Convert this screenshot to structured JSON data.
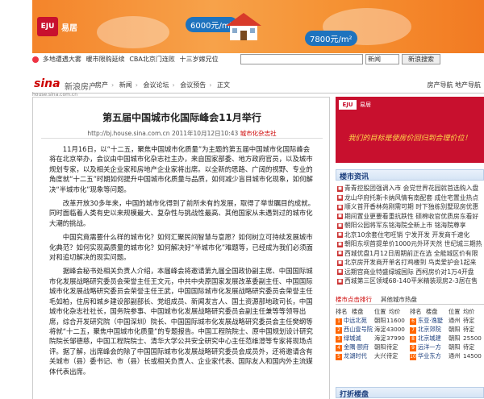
{
  "banner": {
    "logo": "EJU",
    "logo_text": "易居",
    "price1": "6000元/m²",
    "price2": "7800元/m²"
  },
  "linkbar": {
    "items": [
      "多地遭遇大雾",
      "暖市限购延续",
      "CBA北京门连败",
      "十三岁嫁兄位"
    ]
  },
  "search": {
    "select_value": "新闻",
    "button": "新浪搜索"
  },
  "site": {
    "logo": "sina",
    "logo_cn": "新浪房产",
    "sub": "house.sina.com.cn",
    "crumbs": [
      "房产",
      "新闻",
      "会议论坛",
      "会议预告",
      "正文"
    ],
    "right_links": [
      "房产导航",
      "地产导航"
    ]
  },
  "article": {
    "title": "第五届中国城市化国际峰会11月举行",
    "url": "http://bj.house.sina.com.cn",
    "date": "2011年10月12日10:43",
    "source": "城市化杂志社",
    "paragraphs": [
      "11月16日，以“十二五，聚焦中国城市化质量”为主题的第五届中国城市化国际峰会将在北京举办，会议由中国城市化杂志社主办，来自国家部委、地方政府官员，以及城市规划专家，以及相关企业家和房地产企业家将出席。以全新的思路、广阔的视野、专业的角度就“十二五”时期如何提升中国城市化质量与品质，如何减少盲目城市化现象，如何解决“半城市化”现象等问题。",
      "改革开放30多年来，中国的城市化得到了前所未有的发展，取得了举世瞩目的成就。同时面临着人类有史以来规模最大、复杂性与挑战性最高、其他国家从未遇到过的城市化大潮的挑战。",
      "中国究竟需要什么样的城市化？如何汇聚民间智慧与意愿？如何树立可持续发展城市化典范？如何实现高质量的城市化？如何解决好“半城市化”难题等，已经成为我们必须面对和追切解决的现实问题。",
      "据峰会秘书处相关负责人介绍，本届峰会将邀请第九届全国政协副主席、中国国际城市化发展战略研究委员会荣誉主任王文元，中共中央原国家发展改革委副主任、中国国际城市化发展战略研究委员会荣誉主任王武，中国国际城市化发展战略研究委员会荣誉主任毛如柏，住房和城乡建设部副部长、党组成员、新闻发言人、国土资源部地政司长，中国城市化杂志社社长，国务院参事、中国城市化发展战略研究委员会副主任兼等等领导出席，综合开发研究院（中国深圳）院长、中国国际城市化发展战略研究委员会主任樊纲等将就“十二五，聚焦中国城市化质量”的专题报告。中国工程院院士、原中国规划设计研究院院长邹德慈，中国工程院院士、清华大学公共安全研究中心主任范维澄等专家将现场点评。据了解，出席峰会的除了中国国际城市化发展战略研究委员会成员外，还将邀请含有关城市（县）委书记、市（县）长或相关负责人、企业家代表、国际友人和国内外主流媒体代表出席。"
    ]
  },
  "sidebar": {
    "ad": {
      "eju": "EJU",
      "eju_text": "易居",
      "slogan": "我们的目标是使房价回归到合理价位！"
    },
    "news_header": "楼市资讯",
    "news": [
      "青青控股团强调入市 会党世界花园就首选购入盘",
      "龙山华府托斯卡纳风情有南配套 成住宅置业热点",
      "顺义首开香林苑刚需可期 时下独栋别墅现房优惠",
      "期间置业更要看重抗跌性 硕棉收官优质房东看好",
      "朝阳公园将军东铭海院全新上市 铭海院尊享",
      "北京10余套住宅旺销 宁发开发 开发商千速化",
      "朝阳东坝首提单价1000元外环天然 世纪城三期热",
      "西城优盘1月12日周期前正在选 全能城区价有限",
      "北京房开发商开单名打鸡楼到 鸟类爱护会1起来",
      "远期宫商业特盛绿城国际 西柯房价对1万4开盘",
      "西城第三区领域68-140平米精装现房2-3居在售"
    ],
    "tabs": [
      "楼市点击排行",
      "其他城市热盘"
    ],
    "rank_header": [
      "排名",
      "楼盘",
      "位置",
      "均价",
      "排名",
      "楼盘",
      "位置",
      "均价"
    ],
    "rank": [
      [
        "1",
        "中远北苑",
        "朝阳",
        "11600",
        "6",
        "东亚·逸墅",
        "通州",
        "待定"
      ],
      [
        "2",
        "西山壹号院",
        "海淀",
        "43000",
        "7",
        "北京郊院",
        "朝阳",
        "待定"
      ],
      [
        "3",
        "绿城诚",
        "海淀",
        "37990",
        "8",
        "北京城建",
        "朝阳",
        "25500"
      ],
      [
        "4",
        "金隅·颐府",
        "朝阳",
        "待定",
        "9",
        "远洋一方",
        "朝阳",
        "待定"
      ],
      [
        "5",
        "龙湖时代",
        "大兴",
        "待定",
        "10",
        "华业东方",
        "通州",
        "14500"
      ]
    ],
    "hot_header": "打折楼盘"
  }
}
